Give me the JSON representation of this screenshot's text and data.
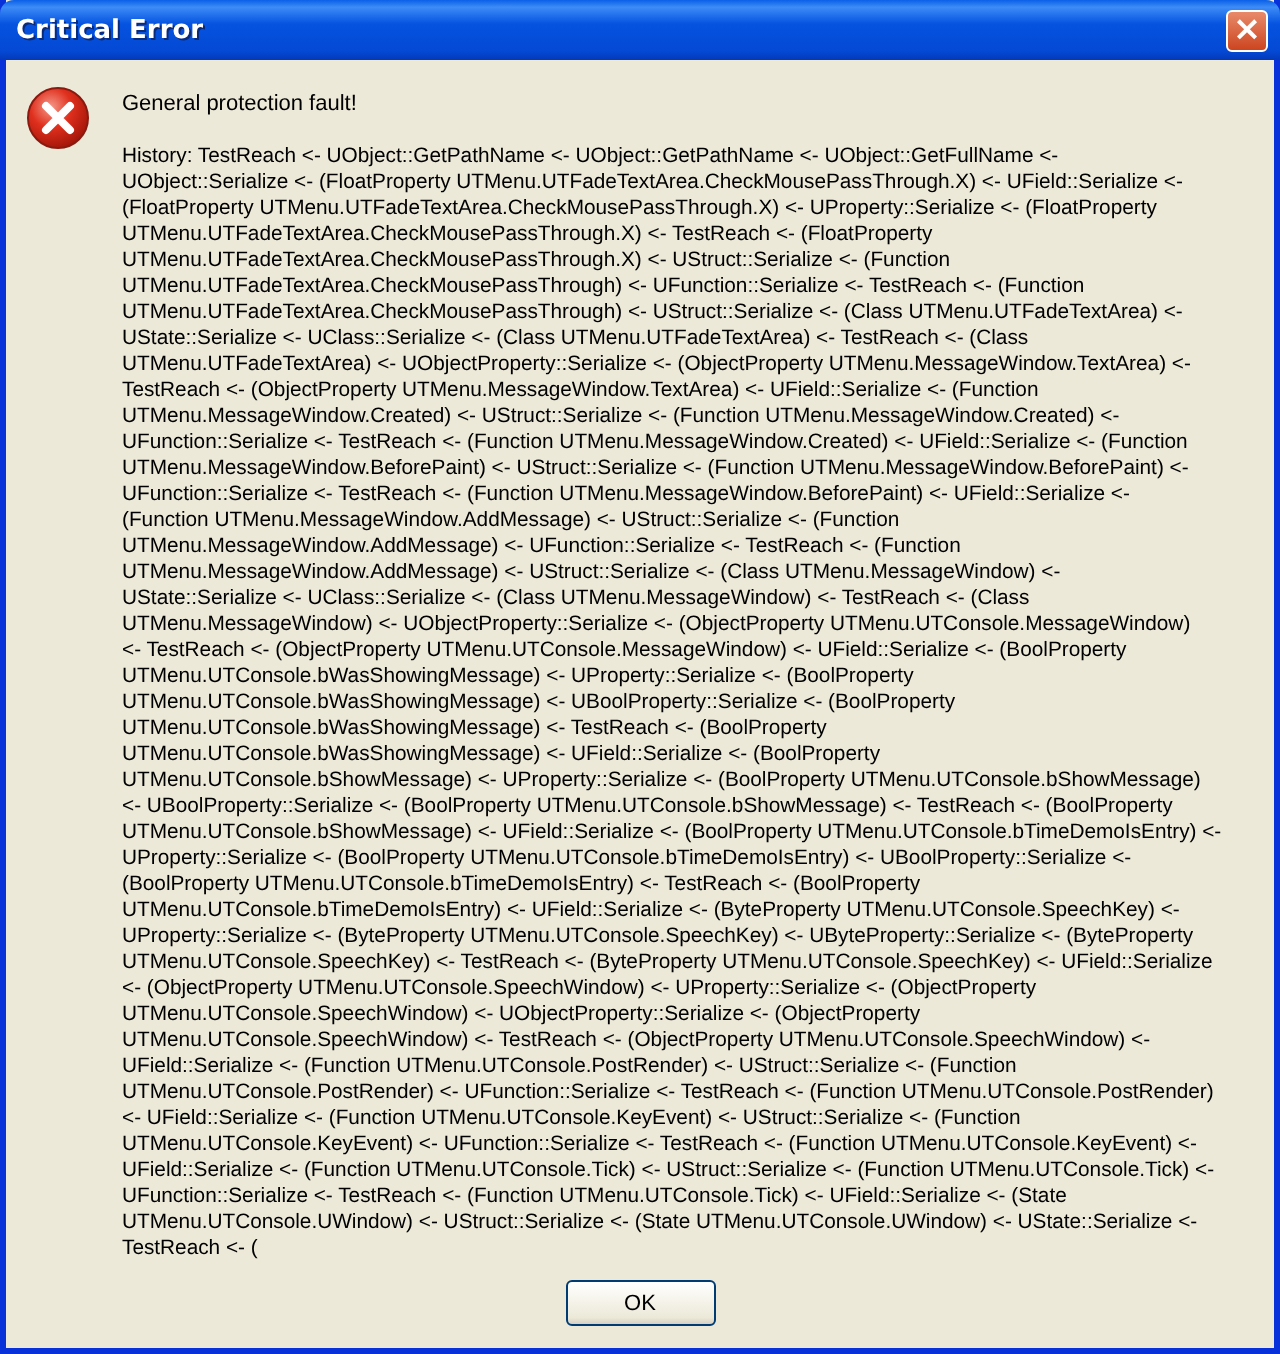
{
  "window": {
    "title": "Critical Error",
    "close": "×"
  },
  "message": "General protection fault!",
  "history_lines": [
    "History: TestReach <- UObject::GetPathName <- UObject::GetPathName <- UObject::GetFullName <-",
    "UObject::Serialize <- (FloatProperty UTMenu.UTFadeTextArea.CheckMousePassThrough.X) <- UField::Serialize <-",
    "(FloatProperty UTMenu.UTFadeTextArea.CheckMousePassThrough.X) <- UProperty::Serialize <- (FloatProperty",
    "UTMenu.UTFadeTextArea.CheckMousePassThrough.X) <- TestReach <- (FloatProperty",
    "UTMenu.UTFadeTextArea.CheckMousePassThrough.X) <- UStruct::Serialize <- (Function",
    "UTMenu.UTFadeTextArea.CheckMousePassThrough) <- UFunction::Serialize <- TestReach <- (Function",
    "UTMenu.UTFadeTextArea.CheckMousePassThrough) <- UStruct::Serialize <- (Class UTMenu.UTFadeTextArea) <-",
    "UState::Serialize <- UClass::Serialize <- (Class UTMenu.UTFadeTextArea) <- TestReach <- (Class",
    "UTMenu.UTFadeTextArea) <- UObjectProperty::Serialize <- (ObjectProperty UTMenu.MessageWindow.TextArea) <-",
    "TestReach <- (ObjectProperty UTMenu.MessageWindow.TextArea) <- UField::Serialize <- (Function",
    "UTMenu.MessageWindow.Created) <- UStruct::Serialize <- (Function UTMenu.MessageWindow.Created) <-",
    "UFunction::Serialize <- TestReach <- (Function UTMenu.MessageWindow.Created) <- UField::Serialize <- (Function",
    "UTMenu.MessageWindow.BeforePaint) <- UStruct::Serialize <- (Function UTMenu.MessageWindow.BeforePaint) <-",
    "UFunction::Serialize <- TestReach <- (Function UTMenu.MessageWindow.BeforePaint) <- UField::Serialize <-",
    "(Function UTMenu.MessageWindow.AddMessage) <- UStruct::Serialize <- (Function",
    "UTMenu.MessageWindow.AddMessage) <- UFunction::Serialize <- TestReach <- (Function",
    "UTMenu.MessageWindow.AddMessage) <- UStruct::Serialize <- (Class UTMenu.MessageWindow) <-",
    "UState::Serialize <- UClass::Serialize <- (Class UTMenu.MessageWindow) <- TestReach <- (Class",
    "UTMenu.MessageWindow) <- UObjectProperty::Serialize <- (ObjectProperty UTMenu.UTConsole.MessageWindow)",
    "<- TestReach <- (ObjectProperty UTMenu.UTConsole.MessageWindow) <- UField::Serialize <- (BoolProperty",
    "UTMenu.UTConsole.bWasShowingMessage) <- UProperty::Serialize <- (BoolProperty",
    "UTMenu.UTConsole.bWasShowingMessage) <- UBoolProperty::Serialize <- (BoolProperty",
    "UTMenu.UTConsole.bWasShowingMessage) <- TestReach <- (BoolProperty",
    "UTMenu.UTConsole.bWasShowingMessage) <- UField::Serialize <- (BoolProperty",
    "UTMenu.UTConsole.bShowMessage) <- UProperty::Serialize <- (BoolProperty UTMenu.UTConsole.bShowMessage)",
    "<- UBoolProperty::Serialize <- (BoolProperty UTMenu.UTConsole.bShowMessage) <- TestReach <- (BoolProperty",
    "UTMenu.UTConsole.bShowMessage) <- UField::Serialize <- (BoolProperty UTMenu.UTConsole.bTimeDemoIsEntry) <-",
    "UProperty::Serialize <- (BoolProperty UTMenu.UTConsole.bTimeDemoIsEntry) <- UBoolProperty::Serialize <-",
    "(BoolProperty UTMenu.UTConsole.bTimeDemoIsEntry) <- TestReach <- (BoolProperty",
    "UTMenu.UTConsole.bTimeDemoIsEntry) <- UField::Serialize <- (ByteProperty UTMenu.UTConsole.SpeechKey) <-",
    "UProperty::Serialize <- (ByteProperty UTMenu.UTConsole.SpeechKey) <- UByteProperty::Serialize <- (ByteProperty",
    "UTMenu.UTConsole.SpeechKey) <- TestReach <- (ByteProperty UTMenu.UTConsole.SpeechKey) <- UField::Serialize",
    "<- (ObjectProperty UTMenu.UTConsole.SpeechWindow) <- UProperty::Serialize <- (ObjectProperty",
    "UTMenu.UTConsole.SpeechWindow) <- UObjectProperty::Serialize <- (ObjectProperty",
    "UTMenu.UTConsole.SpeechWindow) <- TestReach <- (ObjectProperty UTMenu.UTConsole.SpeechWindow) <-",
    "UField::Serialize <- (Function UTMenu.UTConsole.PostRender) <- UStruct::Serialize <- (Function",
    "UTMenu.UTConsole.PostRender) <- UFunction::Serialize <- TestReach <- (Function UTMenu.UTConsole.PostRender)",
    "<- UField::Serialize <- (Function UTMenu.UTConsole.KeyEvent) <- UStruct::Serialize <- (Function",
    "UTMenu.UTConsole.KeyEvent) <- UFunction::Serialize <- TestReach <- (Function UTMenu.UTConsole.KeyEvent) <-",
    "UField::Serialize <- (Function UTMenu.UTConsole.Tick) <- UStruct::Serialize <- (Function UTMenu.UTConsole.Tick) <-",
    "UFunction::Serialize <- TestReach <- (Function UTMenu.UTConsole.Tick) <- UField::Serialize <- (State",
    "UTMenu.UTConsole.UWindow) <- UStruct::Serialize <- (State UTMenu.UTConsole.UWindow) <- UState::Serialize <-",
    "TestReach <- ("
  ],
  "buttons": [
    "OK"
  ]
}
